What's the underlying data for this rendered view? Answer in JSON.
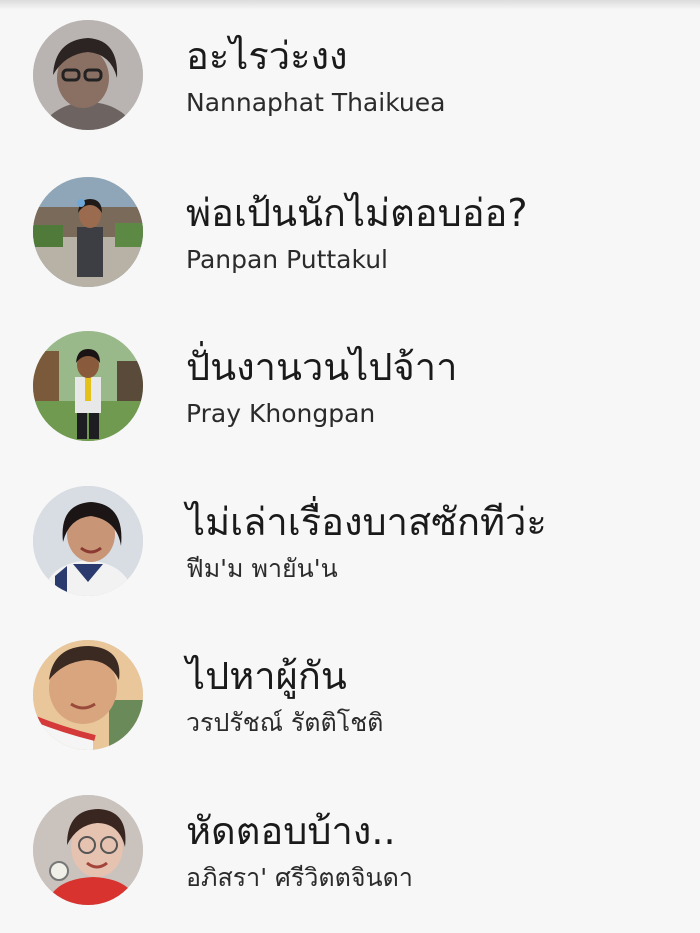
{
  "conversations": [
    {
      "message": "อะไรว่ะงง",
      "sender": "Nannaphat Thaikuea",
      "avatar_colors": {
        "bg": "#b9b4b2",
        "skin": "#8a6f63",
        "hair": "#2b2422",
        "cloth": "#6d6462"
      }
    },
    {
      "message": "พ่อเป้นนักไม่ตอบอ่อ?",
      "sender": "Panpan Puttakul",
      "avatar_colors": {
        "bg": "#8fa6b8",
        "skin": "#9a6b4f",
        "hair": "#1f1a18",
        "cloth": "#3d3d44"
      }
    },
    {
      "message": "ปั่นงานวนไปจ้าา",
      "sender": "Pray Khongpan",
      "avatar_colors": {
        "bg": "#6f9a4f",
        "skin": "#8a5a3c",
        "hair": "#1a1514",
        "cloth": "#1e1e22"
      }
    },
    {
      "message": "ไม่เล่าเรื่องบาสซักทีว่ะ",
      "sender": "ฟีม'ม พายัน'น",
      "avatar_colors": {
        "bg": "#d8dde3",
        "skin": "#c99577",
        "hair": "#1b1615",
        "cloth": "#2a3a6e"
      }
    },
    {
      "message": "ไปหาผู้กัน",
      "sender": "วรปรัชณ์ รัตติโชติ",
      "avatar_colors": {
        "bg": "#e9c79a",
        "skin": "#d9a57e",
        "hair": "#3a2a22",
        "cloth": "#d43a3a"
      }
    },
    {
      "message": "หัดตอบบ้าง..",
      "sender": "อภิสรา' ศรีวิตตจินดา",
      "avatar_colors": {
        "bg": "#c9c2bd",
        "skin": "#e6c2b0",
        "hair": "#3a2620",
        "cloth": "#d8332f"
      }
    }
  ]
}
